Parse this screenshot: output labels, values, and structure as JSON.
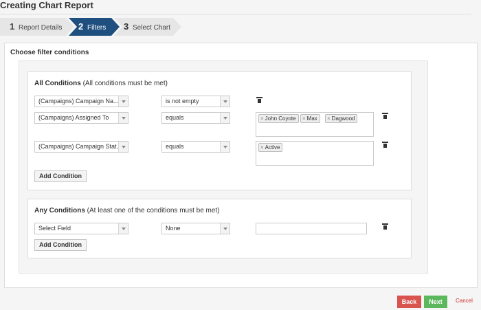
{
  "page": {
    "title": "Creating Chart Report"
  },
  "wizard": {
    "steps": [
      {
        "num": "1",
        "label": "Report Details",
        "state": "completed"
      },
      {
        "num": "2",
        "label": "Filters",
        "state": "active"
      },
      {
        "num": "3",
        "label": "Select Chart",
        "state": "upcoming"
      }
    ]
  },
  "section_title": "Choose filter conditions",
  "all_conditions": {
    "heading_bold": "All Conditions",
    "heading_note": "(All conditions must be met)",
    "rows": [
      {
        "field": "(Campaigns) Campaign Na...",
        "operator": "is not empty",
        "values": []
      },
      {
        "field": "(Campaigns) Assigned To",
        "operator": "equals",
        "values": [
          "John Coyote",
          "Max",
          "Dagwood"
        ]
      },
      {
        "field": "(Campaigns) Campaign Stat...",
        "operator": "equals",
        "values": [
          "Active"
        ]
      }
    ],
    "add_label": "Add Condition"
  },
  "any_conditions": {
    "heading_bold": "Any Conditions",
    "heading_note": "(At least one of the conditions must be met)",
    "rows": [
      {
        "field": "Select Field",
        "operator": "None",
        "value": ""
      }
    ],
    "add_label": "Add Condition"
  },
  "tag_remove_glyph": "×",
  "footer": {
    "back_label": "Back",
    "next_label": "Next",
    "cancel_label": "Cancel"
  },
  "colors": {
    "active_step": "#1f4f7f",
    "back": "#d9534f",
    "next": "#5cb85c",
    "cancel": "#c9302c"
  },
  "icons": {
    "delete": "trash-icon",
    "dropdown": "chevron-down-icon",
    "tag_remove": "close-icon"
  }
}
